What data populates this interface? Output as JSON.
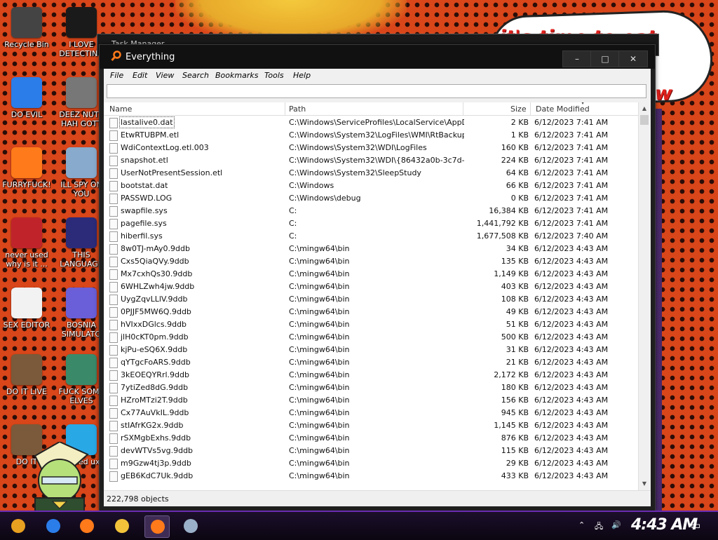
{
  "wallpaper": {
    "speech_lines": [
      "it's time to eat shit",
      "w"
    ]
  },
  "desktop_icons": [
    {
      "label": "Recycle Bin",
      "icon": "recycle-bin-icon",
      "color": "#444444"
    },
    {
      "label": "I LOVE DETECTING",
      "icon": "de-icon",
      "color": "#1a1a1a"
    },
    {
      "label": "DO EVIL",
      "icon": "chrome-icon",
      "color": "#2b7de9"
    },
    {
      "label": "DEEZ NUTS HAH GOTT",
      "icon": "copy-icon",
      "color": "#777777"
    },
    {
      "label": "FURRYFUCK!",
      "icon": "firefox-icon",
      "color": "#ff7a1a"
    },
    {
      "label": "ILL SPY ON YOU",
      "icon": "spy-icon",
      "color": "#88aacc"
    },
    {
      "label": "never used why is it ...",
      "icon": "devcpp-icon",
      "color": "#c0242a"
    },
    {
      "label": "THIS LANGUAGE",
      "icon": "go-icon",
      "color": "#2b2b7a"
    },
    {
      "label": "SEX EDITOR",
      "icon": "hxd-icon",
      "color": "#f2f2f2"
    },
    {
      "label": "BOSNIA SIMULATO",
      "icon": "mine-icon",
      "color": "#6a5fd8"
    },
    {
      "label": "DO IT LIVE",
      "icon": "portrait-icon",
      "color": "#7a5a3a"
    },
    {
      "label": "FUCK SOME ELVES",
      "icon": "elf-icon",
      "color": "#3a8a6a"
    },
    {
      "label": "DO IT",
      "icon": "portrait2-icon",
      "color": "#7a5a3a"
    },
    {
      "label": "Jeweled uxe",
      "icon": "gem-icon",
      "color": "#29a8e6"
    }
  ],
  "taskmgr": {
    "title": "Task Manager"
  },
  "window": {
    "title": "Everything",
    "controls": {
      "minimize": "–",
      "maximize": "□",
      "close": "✕"
    }
  },
  "menu": [
    "File",
    "Edit",
    "View",
    "Search",
    "Bookmarks",
    "Tools",
    "Help"
  ],
  "search": {
    "value": "",
    "placeholder": ""
  },
  "columns": {
    "name": "Name",
    "path": "Path",
    "size": "Size",
    "date": "Date Modified"
  },
  "files": [
    {
      "name": "lastalive0.dat",
      "path": "C:\\Windows\\ServiceProfiles\\LocalService\\AppDat...",
      "size": "2 KB",
      "date": "6/12/2023 7:41 AM"
    },
    {
      "name": "EtwRTUBPM.etl",
      "path": "C:\\Windows\\System32\\LogFiles\\WMI\\RtBackup",
      "size": "1 KB",
      "date": "6/12/2023 7:41 AM"
    },
    {
      "name": "WdiContextLog.etl.003",
      "path": "C:\\Windows\\System32\\WDI\\LogFiles",
      "size": "160 KB",
      "date": "6/12/2023 7:41 AM"
    },
    {
      "name": "snapshot.etl",
      "path": "C:\\Windows\\System32\\WDI\\{86432a0b-3c7d-4d...",
      "size": "224 KB",
      "date": "6/12/2023 7:41 AM"
    },
    {
      "name": "UserNotPresentSession.etl",
      "path": "C:\\Windows\\System32\\SleepStudy",
      "size": "64 KB",
      "date": "6/12/2023 7:41 AM"
    },
    {
      "name": "bootstat.dat",
      "path": "C:\\Windows",
      "size": "66 KB",
      "date": "6/12/2023 7:41 AM"
    },
    {
      "name": "PASSWD.LOG",
      "path": "C:\\Windows\\debug",
      "size": "0 KB",
      "date": "6/12/2023 7:41 AM"
    },
    {
      "name": "swapfile.sys",
      "path": "C:",
      "size": "16,384 KB",
      "date": "6/12/2023 7:41 AM"
    },
    {
      "name": "pagefile.sys",
      "path": "C:",
      "size": "1,441,792 KB",
      "date": "6/12/2023 7:41 AM"
    },
    {
      "name": "hiberfil.sys",
      "path": "C:",
      "size": "1,677,508 KB",
      "date": "6/12/2023 7:40 AM"
    },
    {
      "name": "8w0TJ-mAy0.9ddb",
      "path": "C:\\mingw64\\bin",
      "size": "34 KB",
      "date": "6/12/2023 4:43 AM"
    },
    {
      "name": "Cxs5QiaQVy.9ddb",
      "path": "C:\\mingw64\\bin",
      "size": "135 KB",
      "date": "6/12/2023 4:43 AM"
    },
    {
      "name": "Mx7cxhQs30.9ddb",
      "path": "C:\\mingw64\\bin",
      "size": "1,149 KB",
      "date": "6/12/2023 4:43 AM"
    },
    {
      "name": "6WHLZwh4jw.9ddb",
      "path": "C:\\mingw64\\bin",
      "size": "403 KB",
      "date": "6/12/2023 4:43 AM"
    },
    {
      "name": "UygZqvLLlV.9ddb",
      "path": "C:\\mingw64\\bin",
      "size": "108 KB",
      "date": "6/12/2023 4:43 AM"
    },
    {
      "name": "0PJJF5MW6Q.9ddb",
      "path": "C:\\mingw64\\bin",
      "size": "49 KB",
      "date": "6/12/2023 4:43 AM"
    },
    {
      "name": "hVIxxDGlcs.9ddb",
      "path": "C:\\mingw64\\bin",
      "size": "51 KB",
      "date": "6/12/2023 4:43 AM"
    },
    {
      "name": "jlH0cKT0pm.9ddb",
      "path": "C:\\mingw64\\bin",
      "size": "500 KB",
      "date": "6/12/2023 4:43 AM"
    },
    {
      "name": "kjPu-eSQ6X.9ddb",
      "path": "C:\\mingw64\\bin",
      "size": "31 KB",
      "date": "6/12/2023 4:43 AM"
    },
    {
      "name": "qYTgcFoARS.9ddb",
      "path": "C:\\mingw64\\bin",
      "size": "21 KB",
      "date": "6/12/2023 4:43 AM"
    },
    {
      "name": "3kEOEQYRrl.9ddb",
      "path": "C:\\mingw64\\bin",
      "size": "2,172 KB",
      "date": "6/12/2023 4:43 AM"
    },
    {
      "name": "7ytiZed8dG.9ddb",
      "path": "C:\\mingw64\\bin",
      "size": "180 KB",
      "date": "6/12/2023 4:43 AM"
    },
    {
      "name": "HZroMTzi2T.9ddb",
      "path": "C:\\mingw64\\bin",
      "size": "156 KB",
      "date": "6/12/2023 4:43 AM"
    },
    {
      "name": "Cx77AuVkIL.9ddb",
      "path": "C:\\mingw64\\bin",
      "size": "945 KB",
      "date": "6/12/2023 4:43 AM"
    },
    {
      "name": "stIAfrKG2x.9ddb",
      "path": "C:\\mingw64\\bin",
      "size": "1,145 KB",
      "date": "6/12/2023 4:43 AM"
    },
    {
      "name": "rSXMgbExhs.9ddb",
      "path": "C:\\mingw64\\bin",
      "size": "876 KB",
      "date": "6/12/2023 4:43 AM"
    },
    {
      "name": "devWTVs5vg.9ddb",
      "path": "C:\\mingw64\\bin",
      "size": "115 KB",
      "date": "6/12/2023 4:43 AM"
    },
    {
      "name": "m9Gzw4tj3p.9ddb",
      "path": "C:\\mingw64\\bin",
      "size": "29 KB",
      "date": "6/12/2023 4:43 AM"
    },
    {
      "name": "gEB6KdC7Uk.9ddb",
      "path": "C:\\mingw64\\bin",
      "size": "433 KB",
      "date": "6/12/2023 4:43 AM"
    }
  ],
  "status": {
    "objects": "222,798 objects"
  },
  "taskbar": {
    "clock": "4:43 AM",
    "apps": [
      {
        "icon": "start-icon",
        "color": "#e8a020"
      },
      {
        "icon": "chrome-icon",
        "color": "#2b7de9"
      },
      {
        "icon": "firefox-icon",
        "color": "#ff7a1a"
      },
      {
        "icon": "file-explorer-icon",
        "color": "#f2c33a"
      },
      {
        "icon": "everything-search-icon",
        "color": "#ff7a1a"
      },
      {
        "icon": "task-manager-icon",
        "color": "#9ab0c8"
      }
    ]
  }
}
